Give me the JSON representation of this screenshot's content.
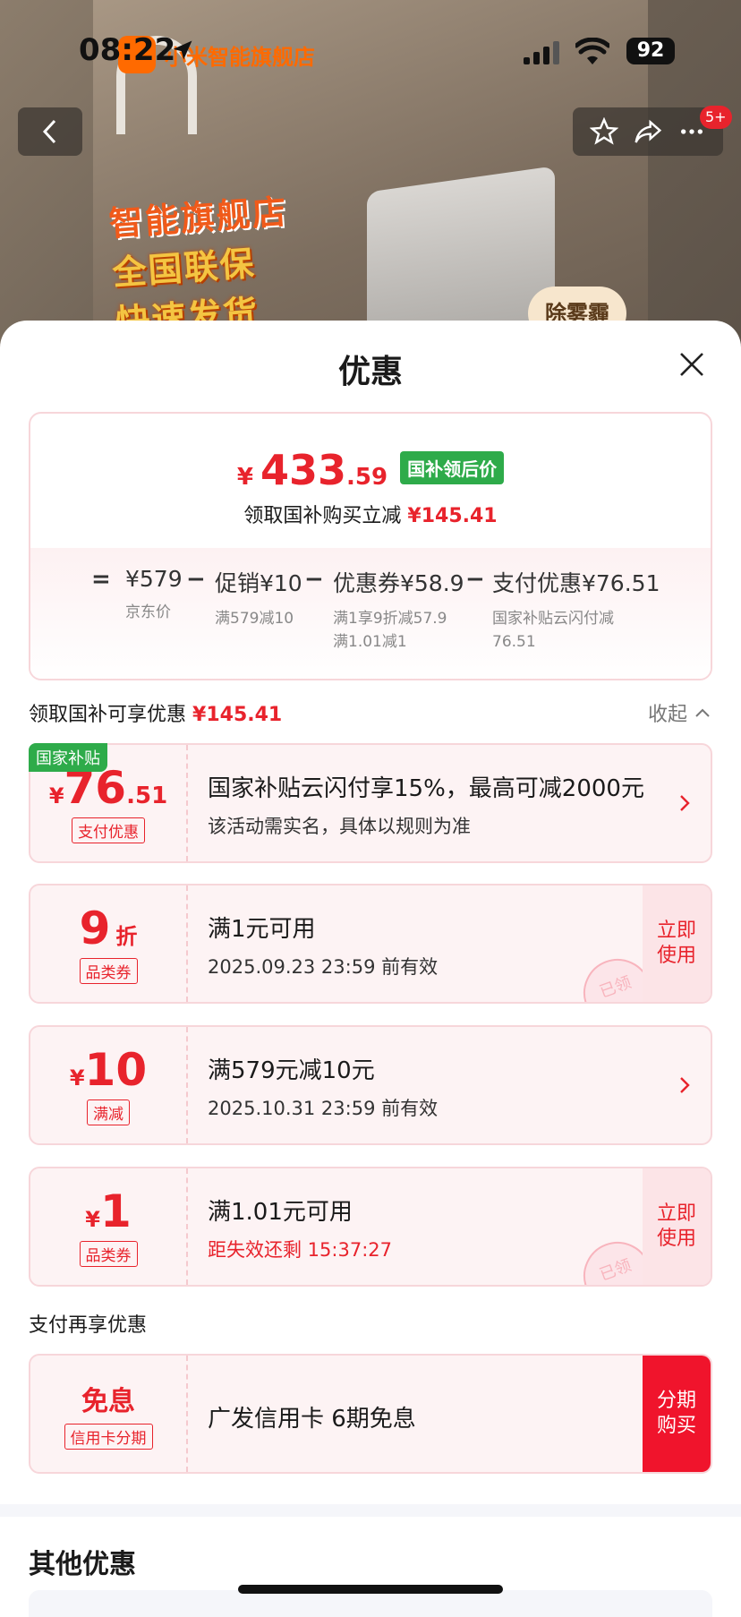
{
  "status_bar": {
    "time": "08:22",
    "battery": "92"
  },
  "background": {
    "store_name": "小米智能旗舰店",
    "sign_lines": [
      "智能旗舰店",
      "全国联保",
      "快速发货"
    ],
    "badge": "除雾霾"
  },
  "nav": {
    "badge": "5+"
  },
  "sheet": {
    "title": "优惠",
    "summary": {
      "price_yen": "¥",
      "price_int": "433",
      "price_dec": ".59",
      "price_tag": "国补领后价",
      "save_text": "领取国补购买立减",
      "save_amount": "¥145.41",
      "formula": {
        "eq": "=",
        "items": [
          {
            "main": "¥579",
            "sub": "京东价"
          },
          {
            "main": "促销¥10",
            "sub": "满579减10"
          },
          {
            "main": "优惠券¥58.9",
            "sub": "满1享9折减57.9",
            "sub2": "满1.01减1"
          },
          {
            "main": "支付优惠¥76.51",
            "sub": "国家补贴云闪付减",
            "sub2": "76.51"
          }
        ],
        "op": "−"
      }
    },
    "section1": {
      "label": "领取国补可享优惠",
      "amount": "¥145.41",
      "collapse": "收起"
    },
    "coupons": [
      {
        "corner": "国家补贴",
        "yen": "¥",
        "num": "76",
        "dec": ".51",
        "label": "支付优惠",
        "t1": "国家补贴云闪付享15%，最高可减2000元",
        "t2": "该活动需实名，具体以规则为准"
      },
      {
        "num": "9",
        "unit": "折",
        "label": "品类券",
        "t1": "满1元可用",
        "t2": "2025.09.23 23:59 前有效",
        "action": "立即使用",
        "stamp": "已领"
      },
      {
        "yen": "¥",
        "num": "10",
        "label": "满减",
        "t1": "满579元减10元",
        "t2": "2025.10.31 23:59 前有效"
      },
      {
        "yen": "¥",
        "num": "1",
        "label": "品类券",
        "t1": "满1.01元可用",
        "t2": "距失效还剩 15:37:27",
        "action": "立即使用",
        "stamp": "已领"
      }
    ],
    "section2": {
      "label": "支付再享优惠"
    },
    "pay_coupon": {
      "big": "免息",
      "label": "信用卡分期",
      "t1": "广发信用卡 6期免息",
      "action": "分期购买"
    },
    "other_title": "其他优惠"
  },
  "colors": {
    "accent_red": "#e8232c",
    "green_tag": "#2eab4a"
  }
}
